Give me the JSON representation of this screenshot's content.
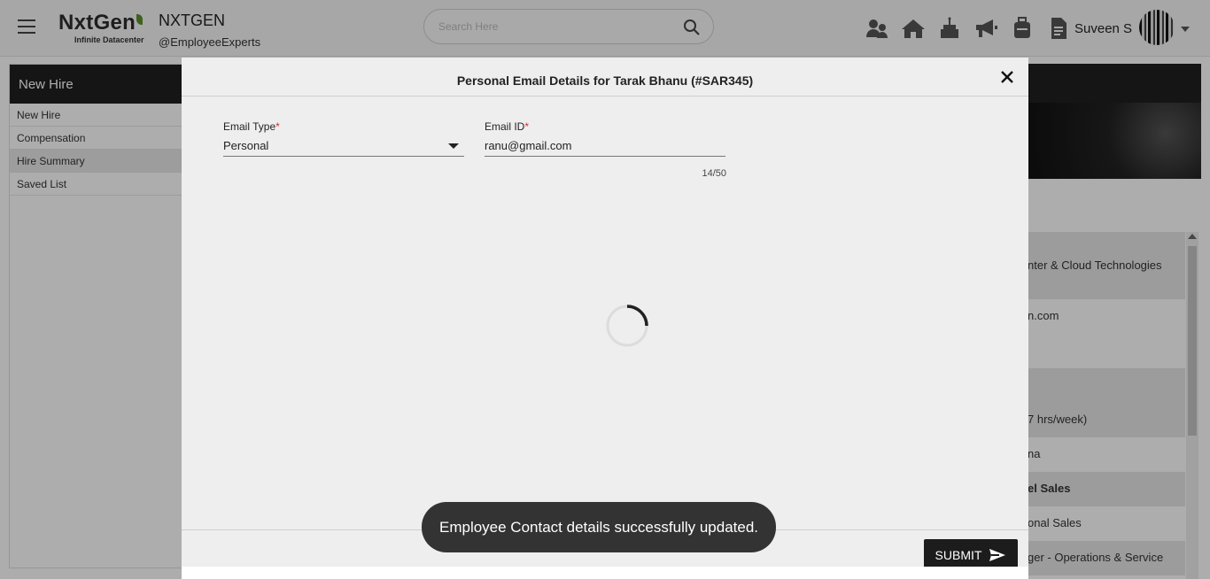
{
  "header": {
    "logo_text": "NxtGen",
    "logo_subtitle": "Infinite Datacenter",
    "company_name": "NXTGEN",
    "company_handle": "@EmployeeExperts",
    "search_placeholder": "Search Here",
    "user_name": "Suveen S",
    "icons": [
      "team-icon",
      "home-icon",
      "birthday-cake-icon",
      "megaphone-icon",
      "luggage-icon",
      "document-icon"
    ]
  },
  "sidebar": {
    "title": "New Hire",
    "items": [
      {
        "label": "New Hire"
      },
      {
        "label": "Compensation"
      },
      {
        "label": "Hire Summary"
      },
      {
        "label": "Saved List"
      }
    ]
  },
  "background_list": [
    {
      "text": "nter & Cloud Technologies"
    },
    {
      "text": "n.com"
    },
    {
      "text": ""
    },
    {
      "text": ""
    },
    {
      "text": "7 hrs/week)"
    },
    {
      "text": "na"
    },
    {
      "text": "el Sales"
    },
    {
      "text": "onal Sales"
    },
    {
      "text": "ger - Operations & Service"
    }
  ],
  "modal": {
    "title": "Personal Email Details for Tarak Bhanu (#SAR345)",
    "email_type_label": "Email Type",
    "email_type_value": "Personal",
    "email_id_label": "Email ID",
    "email_id_value": "ranu@gmail.com",
    "char_counter": "14/50",
    "submit_label": "SUBMIT",
    "required_marker": "*"
  },
  "toast": {
    "message": "Employee Contact details successfully updated."
  },
  "colors": {
    "accent_dark": "#1c1c1c",
    "required": "#d32f2f",
    "logo_green": "#5c8f2c"
  }
}
